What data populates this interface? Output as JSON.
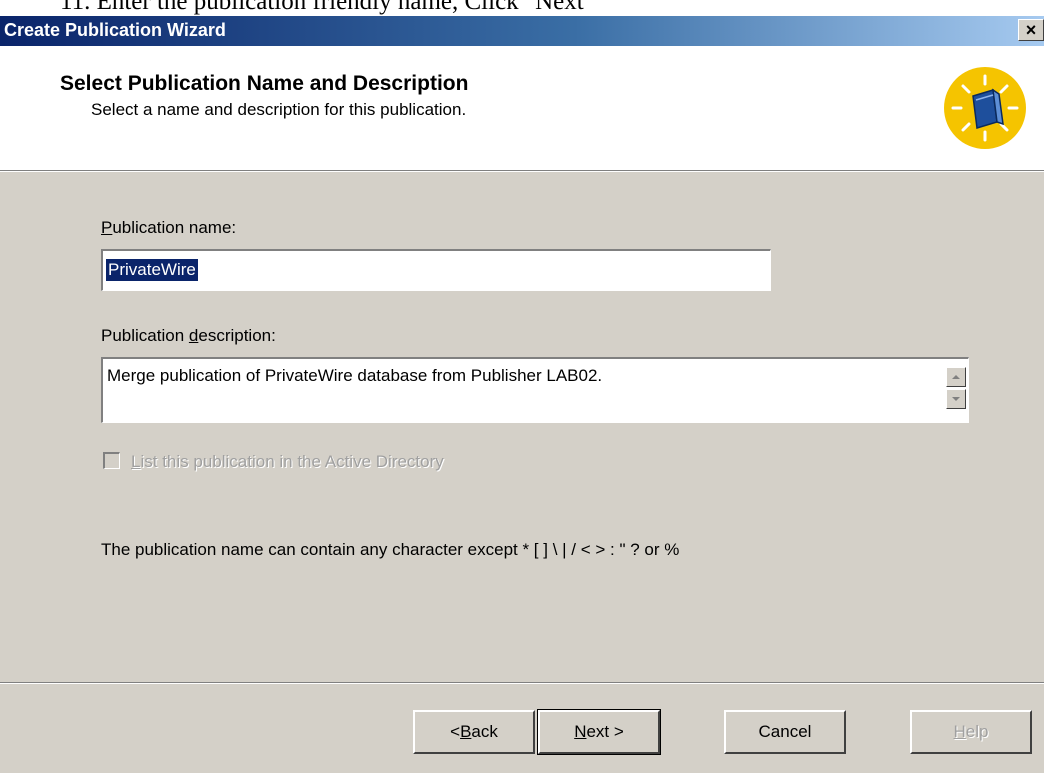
{
  "document": {
    "caption": "11. Enter the publication friendly name, Click \"Next\""
  },
  "window": {
    "title": "Create Publication Wizard",
    "close_glyph": "×"
  },
  "header": {
    "title": "Select Publication Name and Description",
    "subtitle": "Select a name and description for this publication.",
    "icon": "wizard-book-icon"
  },
  "form": {
    "name_label": {
      "mnemonic": "P",
      "rest": "ublication name:"
    },
    "name_value": "PrivateWire",
    "description_label": {
      "before": "Publication ",
      "mnemonic": "d",
      "after": "escription:"
    },
    "description_value": "Merge publication of PrivateWire database from Publisher LAB02.",
    "checkbox": {
      "mnemonic": "L",
      "rest": "ist this publication in the Active Directory",
      "checked": false,
      "enabled": false
    },
    "hint": "The publication name can contain any character except * [ ] \\ | / < > : \" ? or %"
  },
  "buttons": {
    "back": {
      "prefix": "< ",
      "mnemonic": "B",
      "rest": "ack"
    },
    "next": {
      "mnemonic": "N",
      "rest": "ext >"
    },
    "cancel": "Cancel",
    "help": {
      "mnemonic": "H",
      "rest": "elp",
      "enabled": false
    }
  },
  "colors": {
    "title_gradient_start": "#0a246a",
    "title_gradient_end": "#a6caf0",
    "dialog_face": "#d4d0c8",
    "selection": "#0a246a",
    "icon_yellow": "#f5c400"
  }
}
